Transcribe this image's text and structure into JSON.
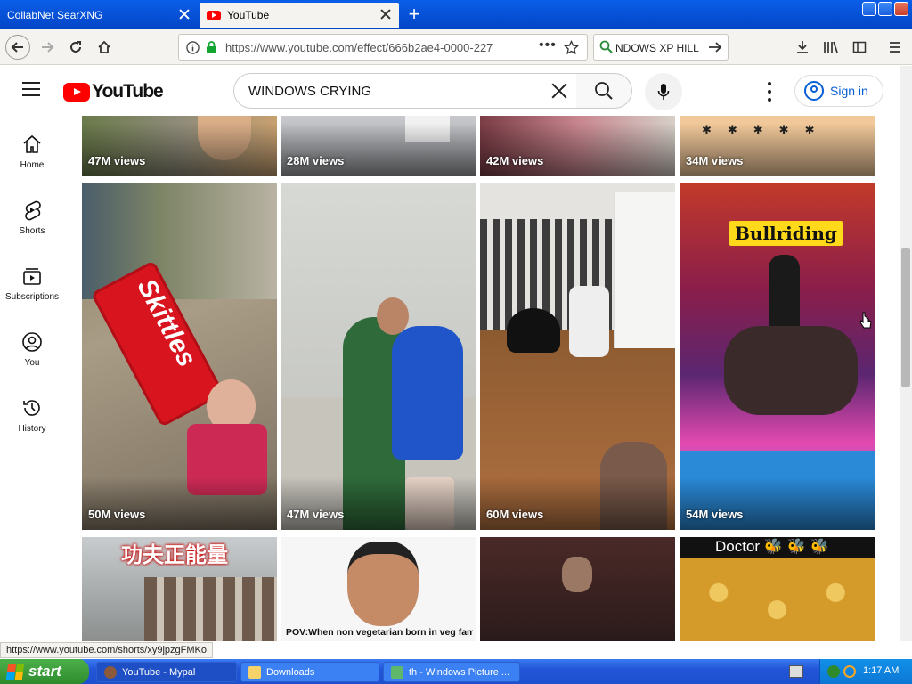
{
  "browser": {
    "tabs": [
      {
        "label": "CollabNet SearXNG"
      },
      {
        "label": "YouTube"
      }
    ],
    "url": "https://www.youtube.com/effect/666b2ae4-0000-227",
    "search_bar_text": "NDOWS XP HILL"
  },
  "youtube": {
    "logo_text": "YouTube",
    "search_query": "WINDOWS CRYING",
    "sign_in_label": "Sign in",
    "sidebar": [
      {
        "label": "Home",
        "icon": "home-icon"
      },
      {
        "label": "Shorts",
        "icon": "shorts-icon"
      },
      {
        "label": "Subscriptions",
        "icon": "subscriptions-icon"
      },
      {
        "label": "You",
        "icon": "you-icon"
      },
      {
        "label": "History",
        "icon": "history-icon"
      }
    ],
    "row1_views": [
      "47M views",
      "28M views",
      "42M views",
      "34M views"
    ],
    "row2": [
      {
        "views": "50M views",
        "overlay": "Skittles"
      },
      {
        "views": "47M views",
        "overlay": ""
      },
      {
        "views": "60M views",
        "overlay": ""
      },
      {
        "views": "54M views",
        "overlay": "Bullriding"
      }
    ],
    "row3": [
      {
        "overlay": "功夫正能量"
      },
      {
        "overlay": "POV:When non vegetarian born in veg family 😂😂"
      },
      {
        "overlay": ""
      },
      {
        "overlay": "Doctor 🐝 🐝 🐝"
      }
    ]
  },
  "status_url": "https://www.youtube.com/shorts/xy9jpzgFMKo",
  "taskbar": {
    "start_label": "start",
    "tasks": [
      {
        "label": "YouTube - Mypal"
      },
      {
        "label": "Downloads"
      },
      {
        "label": "th - Windows Picture ..."
      }
    ],
    "clock": "1:17 AM"
  }
}
